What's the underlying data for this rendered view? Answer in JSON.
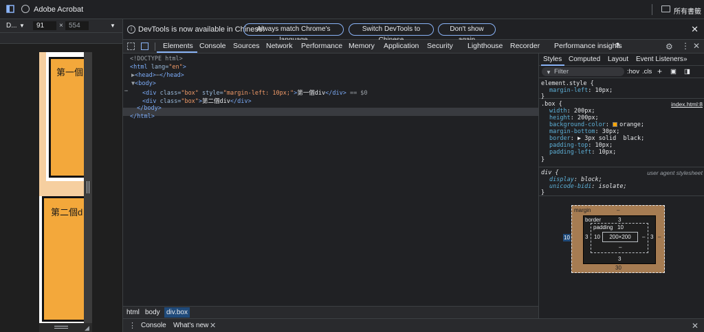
{
  "browser": {
    "app_title": "Adobe Acrobat",
    "bookmarks_label": "所有書籤"
  },
  "device_toolbar": {
    "device": "D...",
    "width": "91",
    "height": "554",
    "times": "×"
  },
  "page_preview": {
    "box1_text": "第一個",
    "box2_text": "第二個d"
  },
  "infobar": {
    "message": "DevTools is now available in Chinese!",
    "btn_match": "Always match Chrome's language",
    "btn_switch": "Switch DevTools to Chinese",
    "btn_dont_show": "Don't show again"
  },
  "tabs": [
    "Elements",
    "Console",
    "Sources",
    "Network",
    "Performance",
    "Memory",
    "Application",
    "Security",
    "Lighthouse",
    "Recorder",
    "Performance insights"
  ],
  "elements_code": {
    "l1": "<!DOCTYPE html>",
    "l2_tag": "<html",
    "l2_attr": "lang=",
    "l2_val": "\"en\"",
    "l2_end": ">",
    "l3": "<head>",
    "l3_ellipsis": "⋯",
    "l3_end": "</head>",
    "l4": "<body>",
    "l5_open": "<div",
    "l5_attr1": "class=",
    "l5_val1": "\"box\"",
    "l5_attr2": "style=",
    "l5_val2": "\"margin-left: 10px;\"",
    "l5_text": "第一個div",
    "l5_close": "</div>",
    "l5_eq": "== $0",
    "l6_text": "第二個div",
    "l7": "</body>",
    "l8": "</html>",
    "dots": "⋯"
  },
  "breadcrumbs": [
    "html",
    "body",
    "div.box"
  ],
  "drawer": {
    "tab_console": "Console",
    "tab_whatsnew": "What's new"
  },
  "styles_pane": {
    "tabs": [
      "Styles",
      "Computed",
      "Layout",
      "Event Listeners"
    ],
    "filter_placeholder": "Filter",
    "hov": ":hov",
    "cls": ".cls",
    "element_style_selector": "element.style {",
    "element_style_decl_prop": "margin-left",
    "element_style_decl_val": "10px;",
    "box_selector": ".box {",
    "box_source": "index.html:8",
    "box_decls": [
      {
        "prop": "width",
        "val": "200px;"
      },
      {
        "prop": "height",
        "val": "200px;"
      },
      {
        "prop": "background-color",
        "val": "orange;"
      },
      {
        "prop": "margin-bottom",
        "val": "30px;"
      },
      {
        "prop": "border",
        "val": "3px solid  black;"
      },
      {
        "prop": "padding-top",
        "val": "10px;"
      },
      {
        "prop": "padding-left",
        "val": "10px;"
      }
    ],
    "div_selector": "div {",
    "div_source": "user agent stylesheet",
    "div_decls": [
      {
        "prop": "display",
        "val": "block;"
      },
      {
        "prop": "unicode-bidi",
        "val": "isolate;"
      }
    ],
    "close_brace": "}",
    "colors": {
      "orange": "#ffa500",
      "black": "#000000"
    }
  },
  "box_model": {
    "margin_label": "margin",
    "margin_top": "–",
    "margin_left": "10",
    "margin_right": "–",
    "margin_bottom": "30",
    "border_label": "border",
    "border_top": "3",
    "border_left": "3",
    "border_right": "3",
    "border_bottom": "3",
    "padding_label": "padding",
    "padding_top": "10",
    "padding_left": "10",
    "padding_right": "–",
    "padding_bottom": "–",
    "content": "200×200"
  }
}
